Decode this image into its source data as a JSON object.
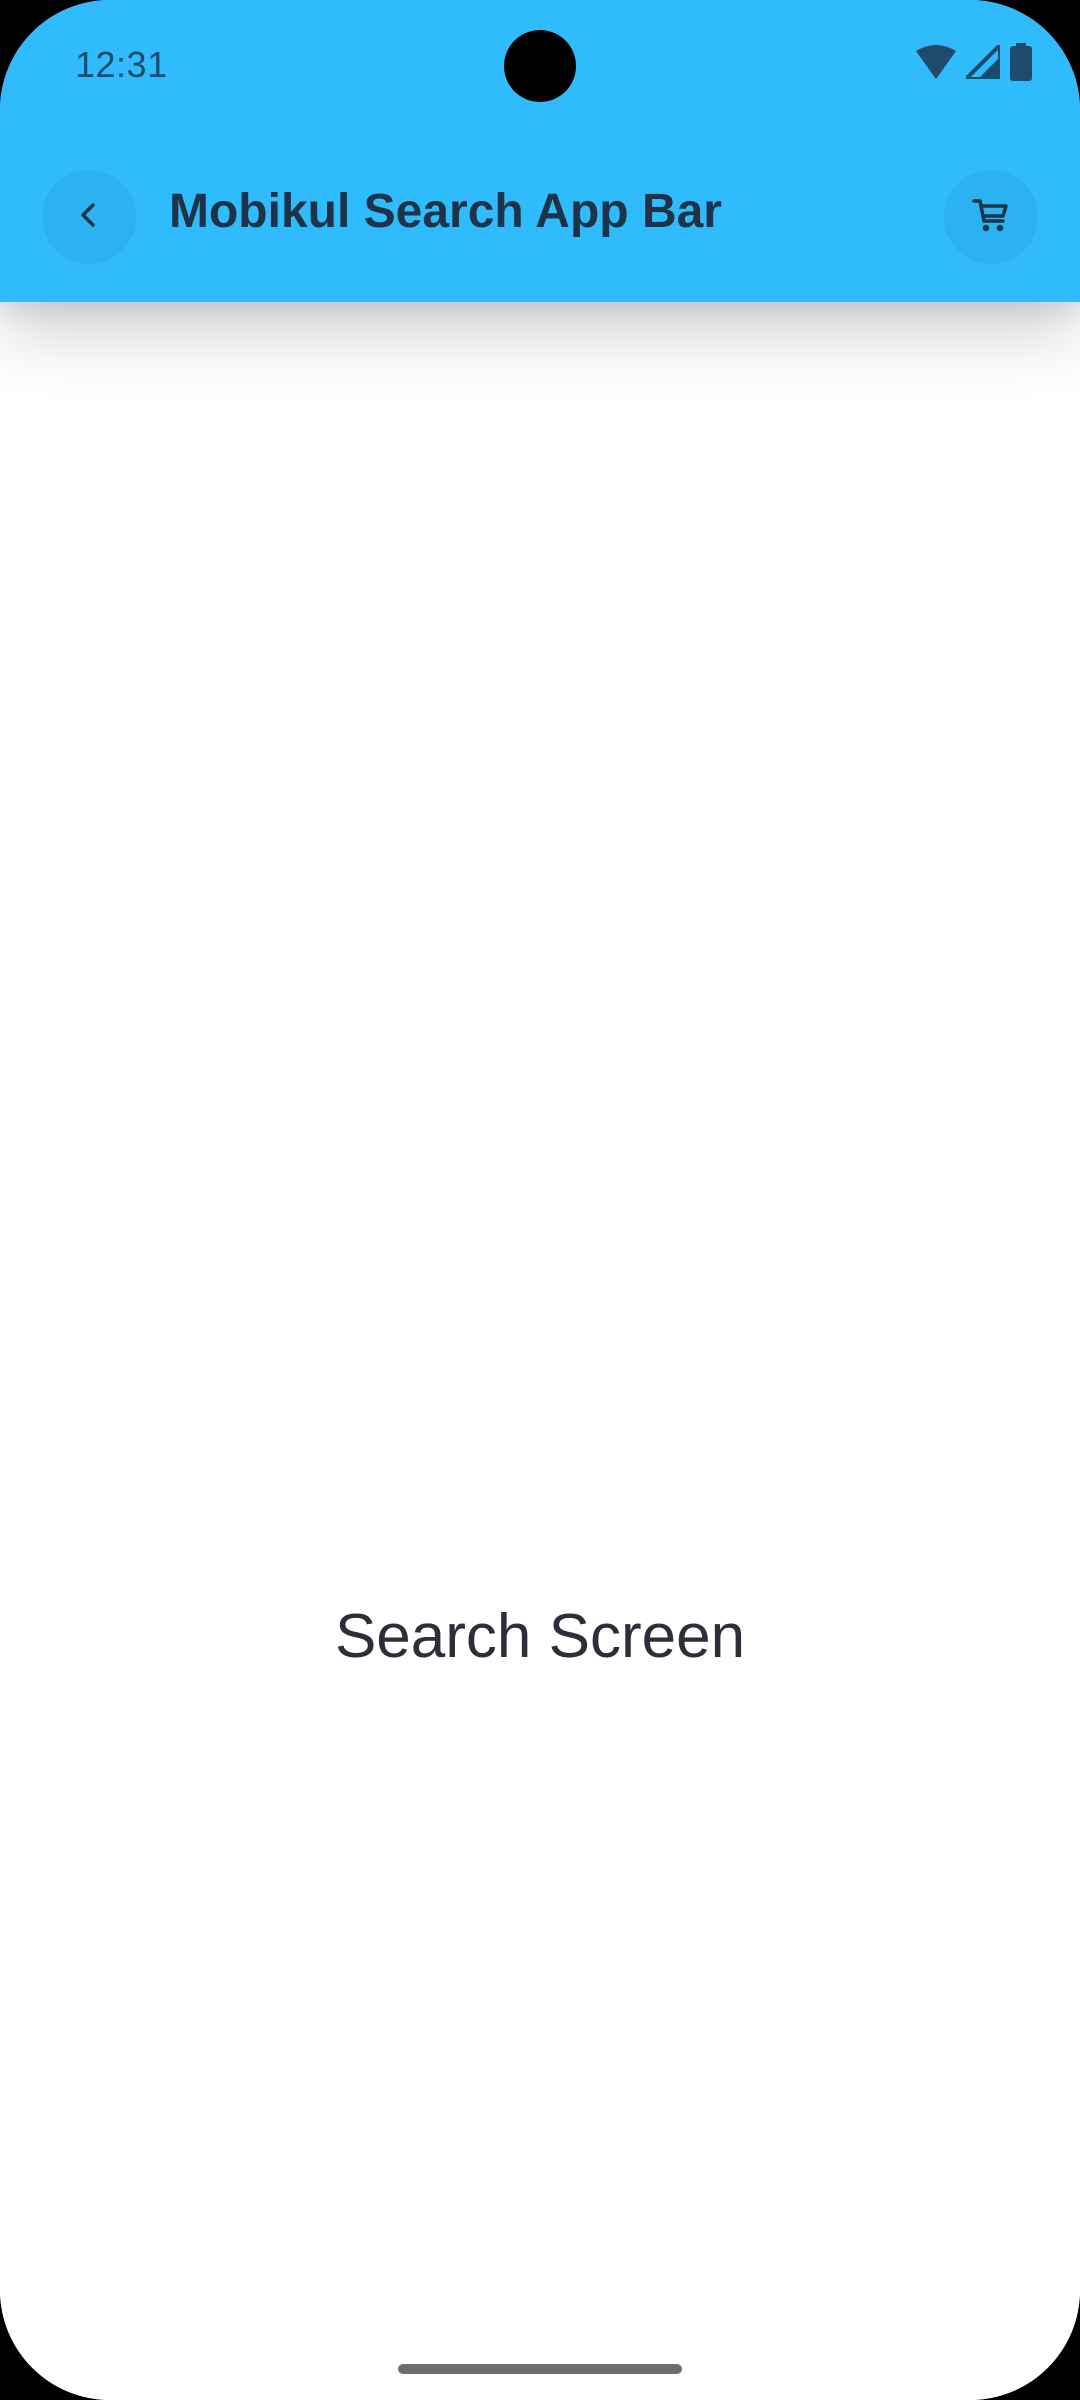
{
  "status_bar": {
    "time": "12:31",
    "icons": [
      "wifi-icon",
      "cell-signal-icon",
      "battery-icon"
    ]
  },
  "app_bar": {
    "title": "Mobikul Search App Bar",
    "back_icon": "chevron-left-icon",
    "cart_icon": "cart-icon",
    "background_color": "#30bbfd"
  },
  "main": {
    "center_text": "Search Screen"
  }
}
